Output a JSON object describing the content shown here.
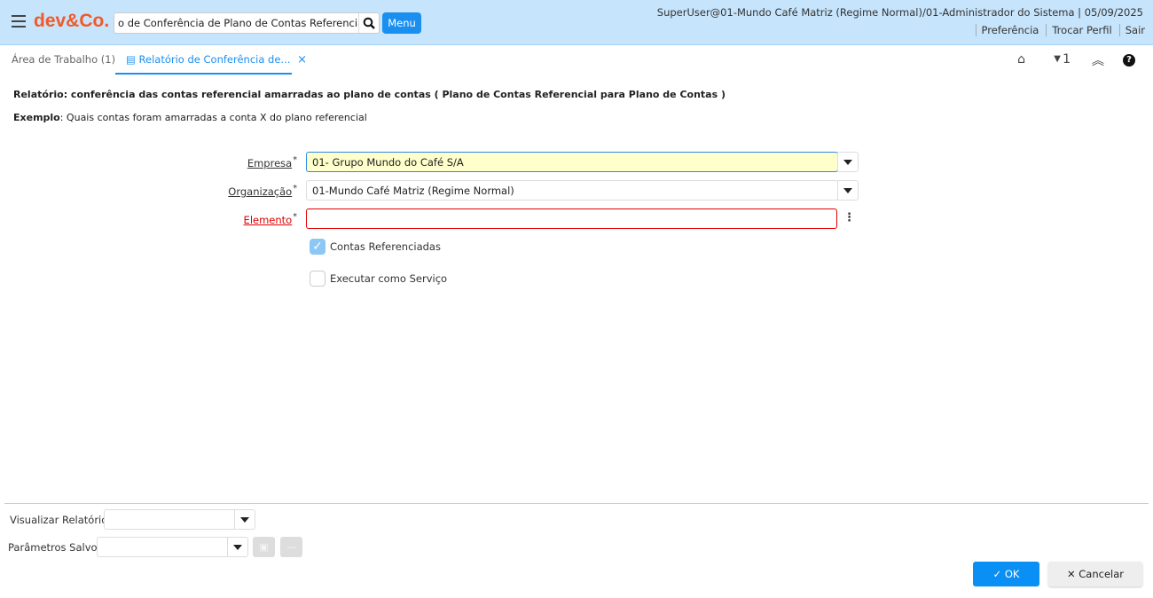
{
  "header": {
    "logo": "dev&Co.",
    "search_value": "o de Conferência de Plano de Contas Referenciados",
    "menu_label": "Menu",
    "user_info": "SuperUser@01-Mundo Café Matriz (Regime Normal)/01-Administrador do Sistema | 05/09/2025",
    "links": [
      "Preferência",
      "Trocar Perfil",
      "Sair"
    ]
  },
  "tabs": [
    {
      "label": "Área de Trabalho (1)"
    },
    {
      "label": "Relatório de Conferência de...",
      "close": "×"
    }
  ],
  "toolbar": {
    "counter": "1"
  },
  "report": {
    "title": "Relatório: conferência das contas referencial amarradas ao plano de contas ( Plano de Contas Referencial para Plano de Contas )",
    "example_label": "Exemplo",
    "example_text": ": Quais contas foram amarradas a conta X do plano referencial"
  },
  "form": {
    "empresa_label": "Empresa",
    "empresa_value": "01- Grupo Mundo do Café S/A",
    "org_label": "Organização",
    "org_value": "01-Mundo Café Matriz (Regime Normal)",
    "elemento_label": "Elemento",
    "elemento_value": "",
    "required": "*",
    "contas_label": "Contas Referenciadas",
    "contas_checked": true,
    "executar_label": "Executar como Serviço",
    "executar_checked": false
  },
  "footer": {
    "visualizar_label": "Visualizar Relatório",
    "visualizar_value": "",
    "parametros_label": "Parâmetros Salvos",
    "parametros_value": "",
    "ok_label": "OK",
    "cancel_label": "Cancelar"
  },
  "colors": {
    "accent": "#1a8ff0",
    "header_bg": "#c6e4fb",
    "logo": "#f05a28",
    "required_error": "#e00000",
    "highlight": "#ffffcc"
  }
}
